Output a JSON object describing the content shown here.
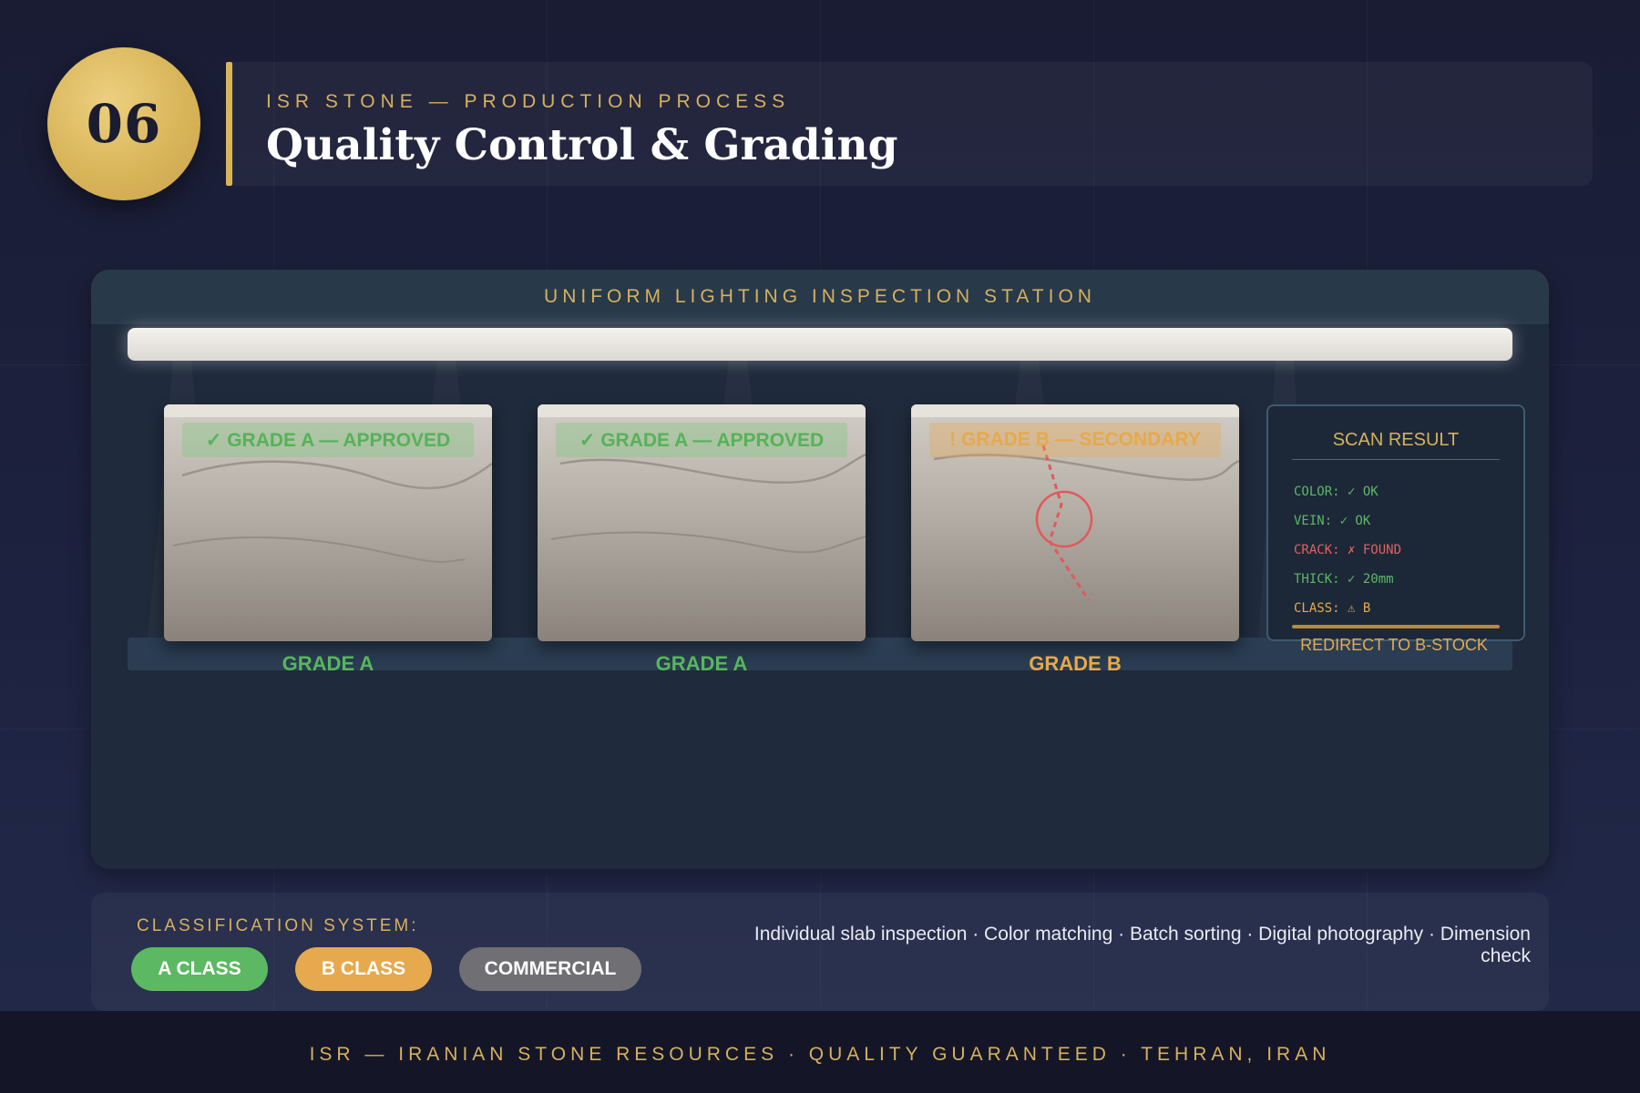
{
  "header": {
    "step_number": "06",
    "kicker": "ISR STONE — PRODUCTION PROCESS",
    "title": "Quality Control & Grading"
  },
  "station": {
    "title": "UNIFORM LIGHTING INSPECTION STATION",
    "slabs": [
      {
        "stamp": "✓ GRADE A — APPROVED",
        "label": "GRADE A",
        "grade": "A"
      },
      {
        "stamp": "✓ GRADE A — APPROVED",
        "label": "GRADE A",
        "grade": "A"
      },
      {
        "stamp": "! GRADE B — SECONDARY",
        "label": "GRADE B",
        "grade": "B"
      }
    ]
  },
  "scan_result": {
    "title": "SCAN RESULT",
    "lines": [
      {
        "text": "COLOR: ✓ OK",
        "status": "ok"
      },
      {
        "text": "VEIN: ✓ OK",
        "status": "ok"
      },
      {
        "text": "CRACK: ✗ FOUND",
        "status": "bad"
      },
      {
        "text": "THICK: ✓ 20mm",
        "status": "ok"
      },
      {
        "text": "CLASS: ⚠ B",
        "status": "warn"
      }
    ],
    "redirect": "REDIRECT TO B-STOCK"
  },
  "classification": {
    "title": "CLASSIFICATION SYSTEM:",
    "classes": [
      "A CLASS",
      "B CLASS",
      "COMMERCIAL"
    ],
    "features": "Individual slab inspection · Color matching · Batch sorting · Digital photography · Dimension check"
  },
  "footer": {
    "text": "ISR — IRANIAN STONE RESOURCES · QUALITY GUARANTEED · TEHRAN, IRAN"
  },
  "colors": {
    "gold": "#d6b15c",
    "grade_a": "#58b65c",
    "grade_b": "#e6a94d",
    "commercial": "#6f6f74",
    "crack": "#e06060"
  }
}
